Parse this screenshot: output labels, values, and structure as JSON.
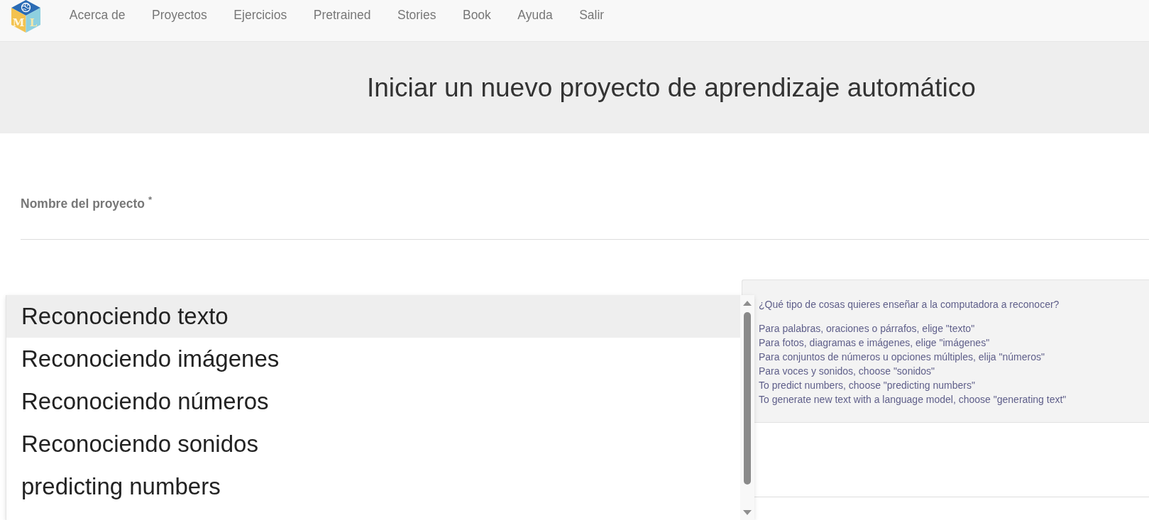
{
  "nav": {
    "logo": {
      "letters": [
        "M",
        "L"
      ]
    },
    "links": [
      "Acerca de",
      "Proyectos",
      "Ejercicios",
      "Pretrained",
      "Stories",
      "Book",
      "Ayuda",
      "Salir"
    ]
  },
  "page_title": "Iniciar un nuevo proyecto de aprendizaje automático",
  "project_name_field": {
    "label": "Nombre del proyecto $^{*}$"
  },
  "type_dropdown": {
    "options": [
      {
        "label": "Reconociendo texto",
        "selected": true
      },
      {
        "label": "Reconociendo imágenes",
        "selected": false
      },
      {
        "label": "Reconociendo números",
        "selected": false
      },
      {
        "label": "Reconociendo sonidos",
        "selected": false
      },
      {
        "label": "predicting numbers",
        "selected": false
      }
    ]
  },
  "help_panel": {
    "question": "¿Qué tipo de cosas quieres enseñar a la computadora a reconocer?",
    "lines": [
      "Para palabras, oraciones o párrafos, elige \"texto\"",
      "Para fotos, diagramas e imágenes, elige \"imágenes\"",
      "Para conjuntos de números u opciones múltiples, elija \"números\"",
      "Para voces y sonidos, choose \"sonidos\"",
      "To predict numbers, choose \"predicting numbers\"",
      "To generate new text with a language model, choose \"generating text\""
    ]
  }
}
